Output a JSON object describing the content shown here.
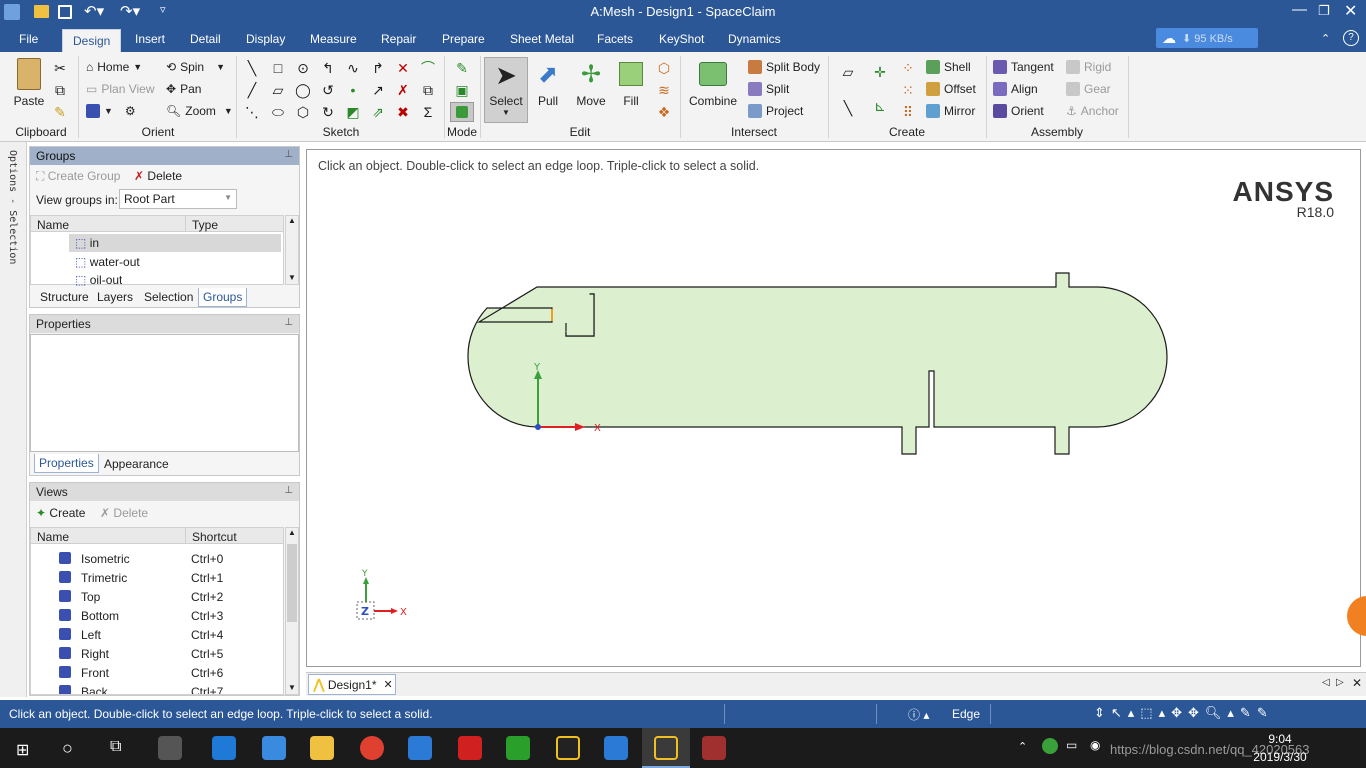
{
  "window": {
    "title": "A:Mesh - Design1 - SpaceClaim",
    "net_speed": "95 KB/s"
  },
  "menu": {
    "file": "File",
    "tabs": [
      "Design",
      "Insert",
      "Detail",
      "Display",
      "Measure",
      "Repair",
      "Prepare",
      "Sheet Metal",
      "Facets",
      "KeyShot",
      "Dynamics"
    ],
    "active_tab": "Design"
  },
  "ribbon": {
    "clipboard": {
      "paste": "Paste",
      "label": "Clipboard"
    },
    "orient": {
      "home": "Home",
      "plan_view": "Plan View",
      "spin": "Spin",
      "pan": "Pan",
      "zoom": "Zoom",
      "label": "Orient"
    },
    "sketch": {
      "label": "Sketch"
    },
    "mode": {
      "label": "Mode"
    },
    "edit": {
      "select": "Select",
      "pull": "Pull",
      "move": "Move",
      "fill": "Fill",
      "label": "Edit"
    },
    "intersect": {
      "combine": "Combine",
      "split_body": "Split Body",
      "split": "Split",
      "project": "Project",
      "label": "Intersect"
    },
    "create": {
      "shell": "Shell",
      "offset": "Offset",
      "mirror": "Mirror",
      "label": "Create"
    },
    "assembly": {
      "tangent": "Tangent",
      "align": "Align",
      "orient": "Orient",
      "rigid": "Rigid",
      "gear": "Gear",
      "anchor": "Anchor",
      "label": "Assembly"
    }
  },
  "left_strip": {
    "label": "Options - Selection"
  },
  "groups_panel": {
    "title": "Groups",
    "create_group": "Create Group",
    "delete": "Delete",
    "view_groups_in_label": "View groups in:",
    "view_groups_in_value": "Root Part",
    "col_name": "Name",
    "col_type": "Type",
    "items": [
      "in",
      "water-out",
      "oil-out"
    ],
    "tabs": [
      "Structure",
      "Layers",
      "Selection",
      "Groups"
    ],
    "active_tab": "Groups"
  },
  "properties_panel": {
    "title": "Properties",
    "tabs": [
      "Properties",
      "Appearance"
    ],
    "active_tab": "Properties"
  },
  "views_panel": {
    "title": "Views",
    "create": "Create",
    "delete": "Delete",
    "col_name": "Name",
    "col_shortcut": "Shortcut",
    "rows": [
      {
        "name": "Isometric",
        "shortcut": "Ctrl+0"
      },
      {
        "name": "Trimetric",
        "shortcut": "Ctrl+1"
      },
      {
        "name": "Top",
        "shortcut": "Ctrl+2"
      },
      {
        "name": "Bottom",
        "shortcut": "Ctrl+3"
      },
      {
        "name": "Left",
        "shortcut": "Ctrl+4"
      },
      {
        "name": "Right",
        "shortcut": "Ctrl+5"
      },
      {
        "name": "Front",
        "shortcut": "Ctrl+6"
      },
      {
        "name": "Back",
        "shortcut": "Ctrl+7"
      }
    ]
  },
  "canvas": {
    "hint": "Click an object. Double-click to select an edge loop. Triple-click to select a solid.",
    "brand": "ANSYS",
    "version": "R18.0",
    "axis_y": "Y",
    "axis_x": "X",
    "axis_z": "Z",
    "colors": {
      "body_fill": "#dcf0d0",
      "outline": "#1a1a1a",
      "y_axis": "#3aa03a",
      "x_axis": "#e02020"
    }
  },
  "doc_tab": {
    "label": "Design1*"
  },
  "status": {
    "message": "Click an object. Double-click to select an edge loop. Triple-click to select a solid.",
    "selection_mode": "Edge"
  },
  "taskbar": {
    "time": "9:04",
    "date": "2019/3/30",
    "watermark": "https://blog.csdn.net/qq_42020563"
  }
}
